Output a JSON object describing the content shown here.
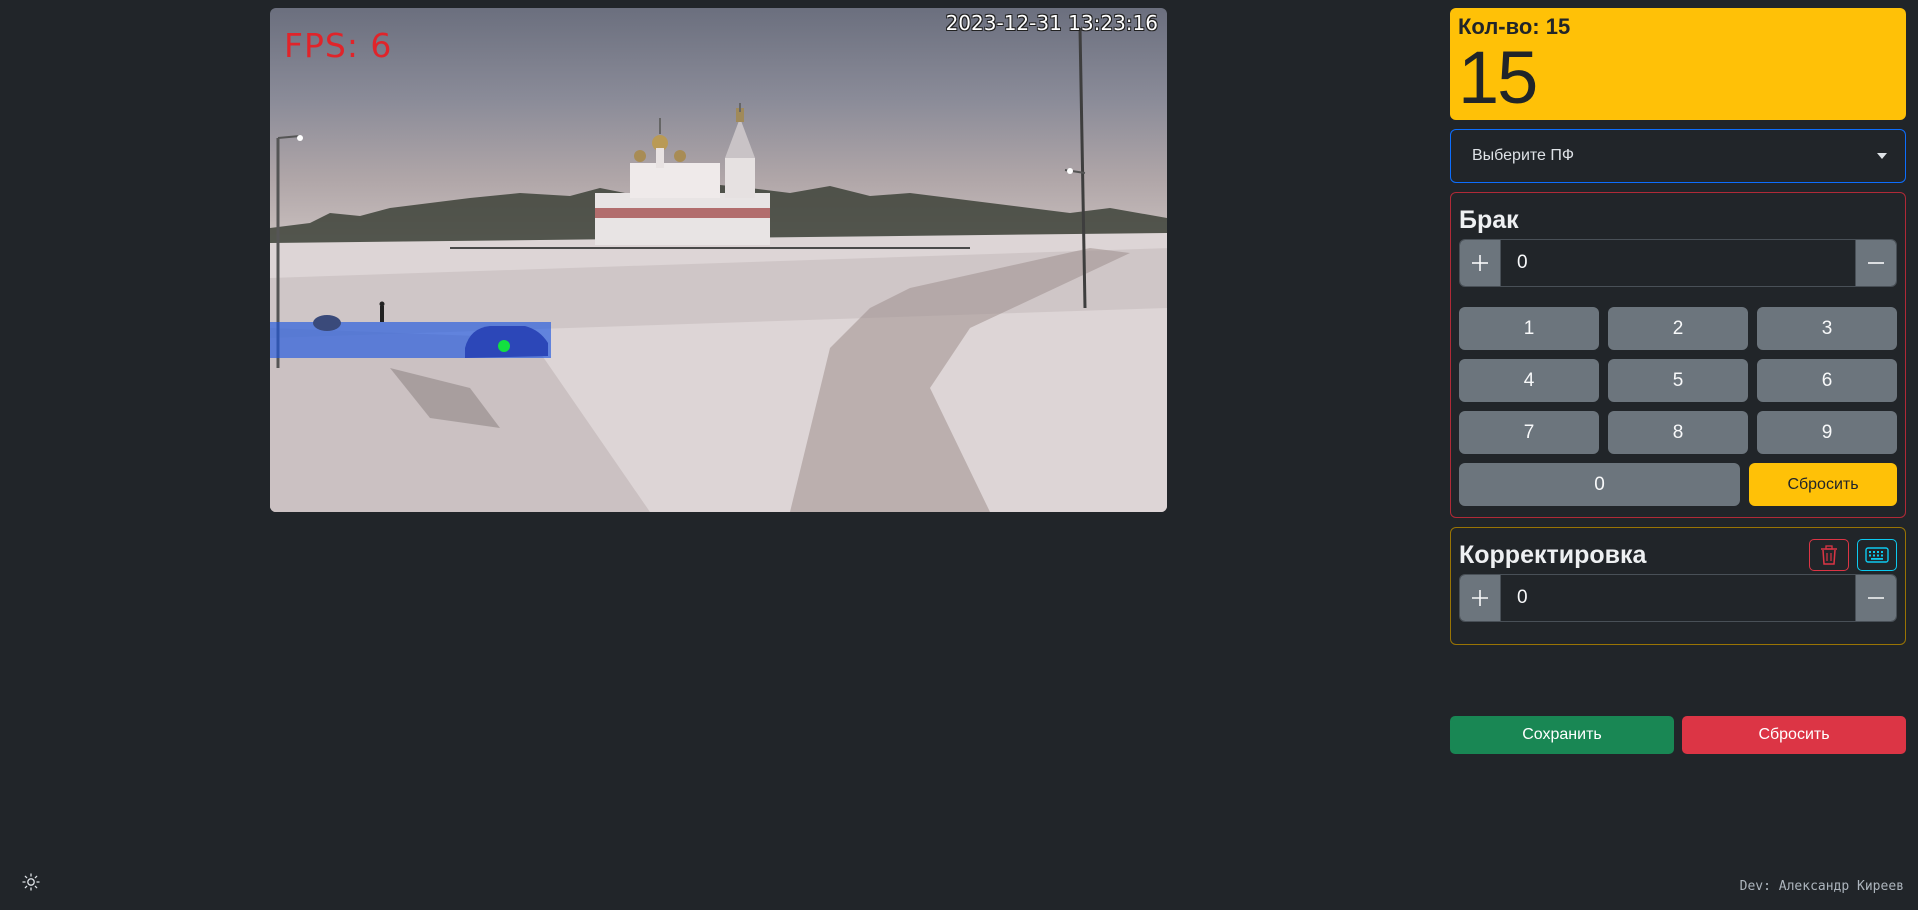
{
  "feed": {
    "fps_label": "FPS: 6",
    "timestamp": "2023-12-31 13:23:16"
  },
  "count": {
    "title": "Кол-во: 15",
    "value": "15"
  },
  "select": {
    "selected": "Выберите ПФ"
  },
  "brak": {
    "title": "Брак",
    "value": "0",
    "keys": [
      "1",
      "2",
      "3",
      "4",
      "5",
      "6",
      "7",
      "8",
      "9"
    ],
    "zero": "0",
    "reset": "Сбросить"
  },
  "korr": {
    "title": "Корректировка",
    "value": "0"
  },
  "actions": {
    "save": "Сохранить",
    "cancel": "Сбросить"
  },
  "footer": {
    "dev": "Dev: Александр Киреев"
  },
  "colors": {
    "background": "#212529",
    "count_card": "#ffc107",
    "select_border": "#0d6efd",
    "brak_border": "#b02a37",
    "korr_border": "#997404",
    "save": "#198754",
    "cancel": "#dc3545"
  },
  "icons": {
    "plus": "plus-icon",
    "minus": "minus-icon",
    "trash": "trash-icon",
    "keyboard": "keyboard-icon",
    "theme": "sun-icon"
  }
}
